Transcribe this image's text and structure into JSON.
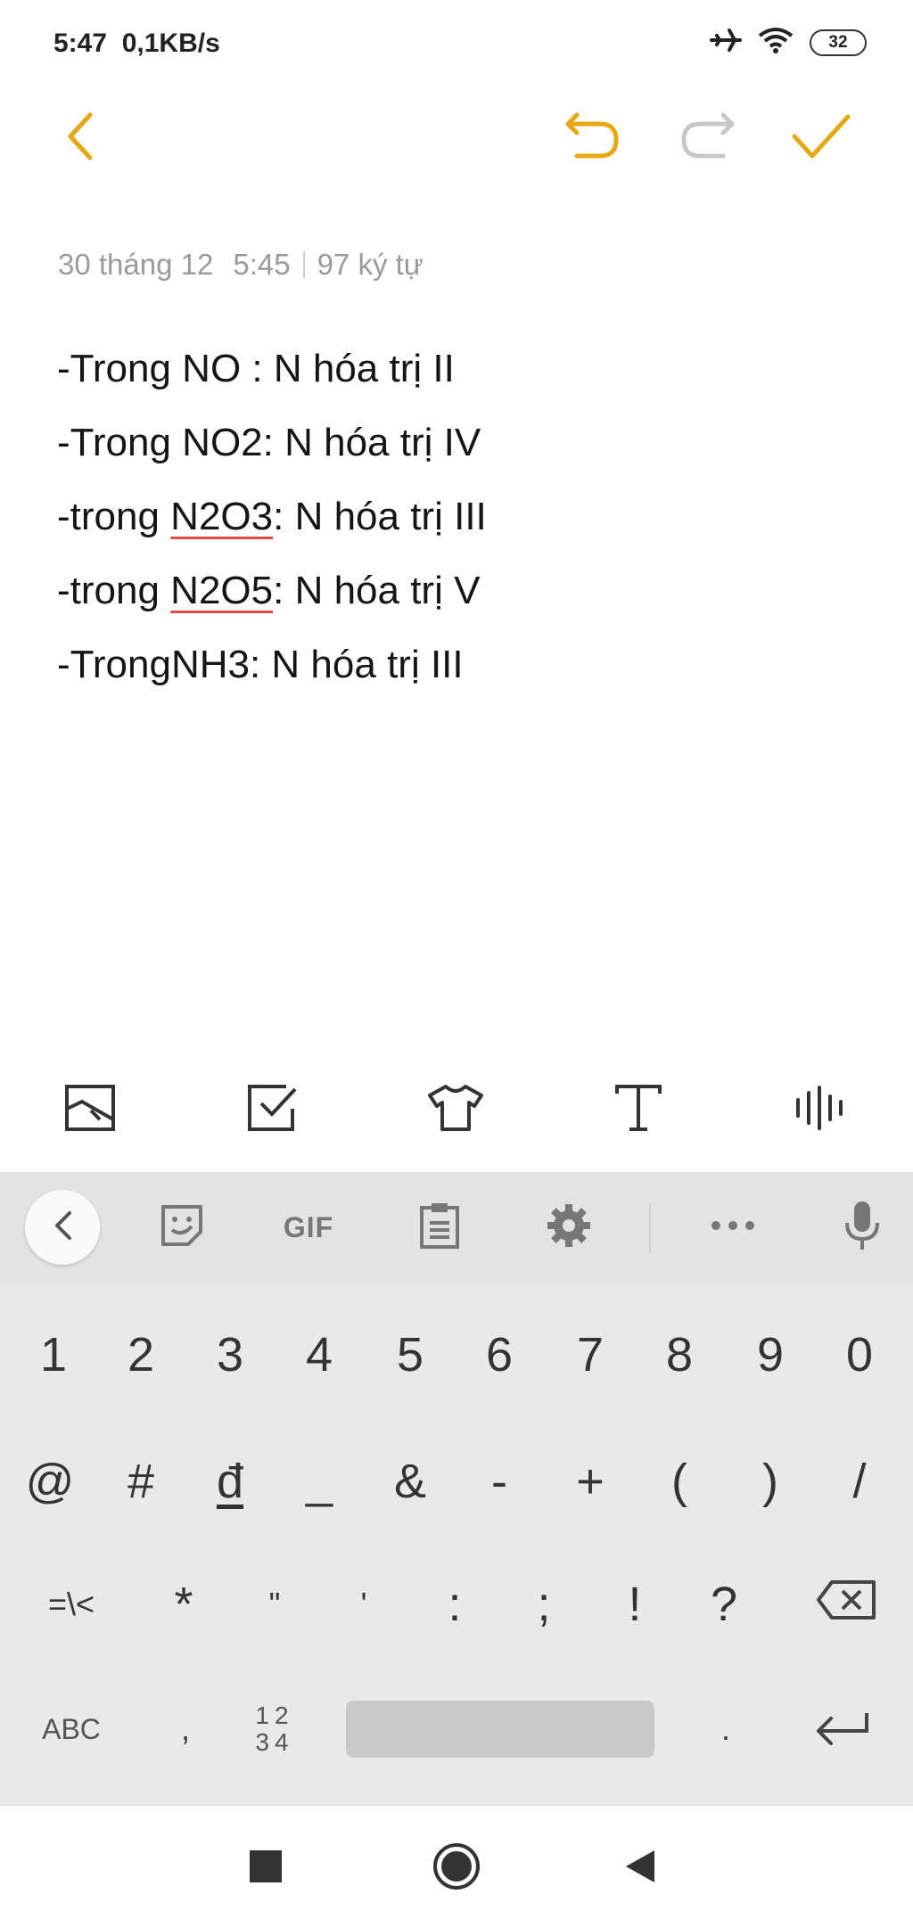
{
  "status_bar": {
    "time": "5:47",
    "speed": "0,1KB/s",
    "battery": "32",
    "icons": [
      "airplane-icon",
      "wifi-icon",
      "battery-icon"
    ]
  },
  "toolbar": {
    "accent_color": "#e5a80f",
    "disabled_color": "#c8c8c8",
    "icons": [
      "back-icon",
      "undo-icon",
      "redo-icon",
      "check-icon"
    ]
  },
  "note": {
    "date": "30 tháng 12",
    "time": "5:45",
    "char_count": "97 ký tự",
    "lines": [
      {
        "pre": "-Trong NO : N hóa trị II",
        "misspelled": "",
        "post": ""
      },
      {
        "pre": "-Trong NO2: N hóa trị IV",
        "misspelled": "",
        "post": ""
      },
      {
        "pre": "-trong ",
        "misspelled": "N2O3",
        "post": ": N hóa trị III"
      },
      {
        "pre": "-trong ",
        "misspelled": "N2O5",
        "post": ": N hóa trị V"
      },
      {
        "pre": "-TrongNH3: N hóa trị III",
        "misspelled": "",
        "post": ""
      }
    ]
  },
  "format_bar": {
    "icons": [
      "image-icon",
      "checklist-icon",
      "theme-icon",
      "text-format-icon",
      "audio-icon"
    ]
  },
  "keyboard": {
    "top_bar": {
      "gif_label": "GIF",
      "icons": [
        "collapse-icon",
        "sticker-icon",
        "clipboard-icon",
        "settings-icon",
        "more-icon",
        "mic-icon"
      ]
    },
    "row1": [
      "1",
      "2",
      "3",
      "4",
      "5",
      "6",
      "7",
      "8",
      "9",
      "0"
    ],
    "row2": [
      "@",
      "#",
      "đ",
      "_",
      "&",
      "-",
      "+",
      "(",
      ")",
      "/"
    ],
    "row3": [
      "=\\<",
      "*",
      "\"",
      "'",
      ":",
      ";",
      "!",
      "?"
    ],
    "row4": {
      "abc": "ABC",
      "comma": ",",
      "num_top": "12",
      "num_bottom": "34",
      "period": "."
    }
  },
  "nav_bar": {
    "icons": [
      "recents-icon",
      "home-icon",
      "back-nav-icon"
    ]
  }
}
